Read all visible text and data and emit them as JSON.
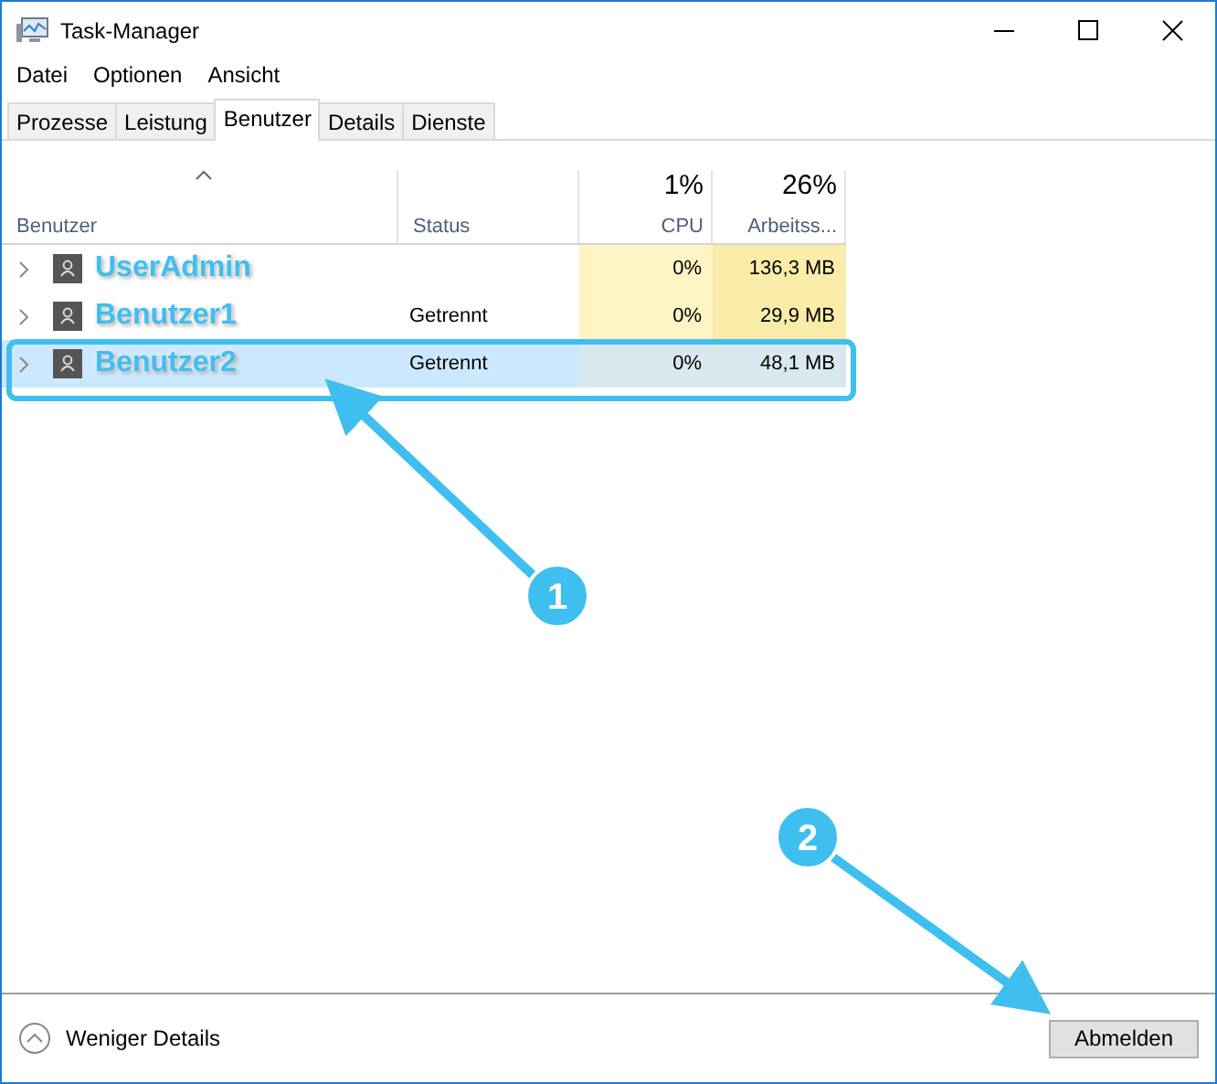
{
  "window": {
    "title": "Task-Manager"
  },
  "menu": [
    "Datei",
    "Optionen",
    "Ansicht"
  ],
  "tabs": [
    {
      "label": "Prozesse",
      "selected": false
    },
    {
      "label": "Leistung",
      "selected": false
    },
    {
      "label": "Benutzer",
      "selected": true
    },
    {
      "label": "Details",
      "selected": false
    },
    {
      "label": "Dienste",
      "selected": false
    }
  ],
  "table": {
    "columns": [
      {
        "name": "Benutzer",
        "sorted": true
      },
      {
        "name": "Status",
        "sorted": false
      },
      {
        "name": "CPU",
        "summary": "1%",
        "sorted": false
      },
      {
        "name": "Arbeitss...",
        "summary": "26%",
        "sorted": false
      }
    ],
    "rows": [
      {
        "user": "UserAdmin",
        "cpu": "0%",
        "memory": "136,3 MB",
        "selected": false
      },
      {
        "user": "Benutzer1",
        "status": "Getrennt",
        "cpu": "0%",
        "memory": "29,9 MB",
        "selected": false
      },
      {
        "user": "Benutzer2",
        "status": "Getrennt",
        "cpu": "0%",
        "memory": "48,1 MB",
        "selected": true
      }
    ]
  },
  "footer": {
    "toggle": "Weniger Details",
    "button": "Abmelden"
  },
  "annotations": [
    {
      "label": "1"
    },
    {
      "label": "2"
    }
  ]
}
